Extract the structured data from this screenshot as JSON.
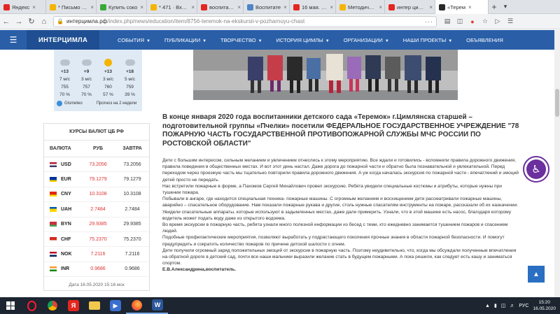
{
  "browser": {
    "tabs": [
      {
        "label": "Яндекс",
        "icon_color": "#e52620",
        "active": false
      },
      {
        "label": "* Письмо «Го",
        "icon_color": "#f5b400",
        "active": false
      },
      {
        "label": "Купить соко",
        "icon_color": "#3aa93a",
        "active": false
      },
      {
        "label": "* 471 · Входящ",
        "icon_color": "#f5b400",
        "active": false
      },
      {
        "label": "воспитател",
        "icon_color": "#e52620",
        "active": false
      },
      {
        "label": "Воспитате",
        "icon_color": "#4f86c6",
        "active": false
      },
      {
        "label": "16 мая. РФ",
        "icon_color": "#e52620",
        "active": false
      },
      {
        "label": "Методическ",
        "icon_color": "#f5b400",
        "active": false
      },
      {
        "label": "интер цимла",
        "icon_color": "#e52620",
        "active": false
      },
      {
        "label": "«Терем",
        "icon_color": "#2a2a2a",
        "active": true
      }
    ],
    "new_tab": "+",
    "url_host": "интерцимла.рф",
    "url_path": "/index.php/news/education/item/8756-teremok-na-ekskursii-v-pozharnuyu-chast",
    "url_menu": "···"
  },
  "site": {
    "brand": "ИНТЕРЦИМЛА",
    "menu": [
      "СОБЫТИЯ",
      "ПУБЛИКАЦИИ",
      "ТВОРЧЕСТВО",
      "ИСТОРИЯ ЦИМЛЫ",
      "ОРГАНИЗАЦИИ",
      "НАШИ ПРОЕКТЫ",
      "ОБЪЯВЛЕНИЯ"
    ],
    "menu_has_dropdown": [
      true,
      true,
      true,
      true,
      true,
      true,
      false
    ]
  },
  "weather": {
    "days": [
      "",
      "",
      "",
      ""
    ],
    "icons": [
      "cloud",
      "cloud",
      "sun",
      "cloud"
    ],
    "temps": [
      "+13",
      "+9",
      "+13",
      "+18"
    ],
    "winds": [
      "7 м/с",
      "3 м/с",
      "3 м/с",
      "5 м/с"
    ],
    "pressure": [
      "755",
      "757",
      "760",
      "759"
    ],
    "humidity": [
      "70 %",
      "70 %",
      "57 %",
      "39 %"
    ],
    "provider": "Gismeteo",
    "forecast_link": "Прогноз на 2 недели"
  },
  "currency": {
    "title": "КУРСЫ ВАЛЮТ ЦБ РФ",
    "headers": [
      "ВАЛЮТА",
      "РУБ",
      "ЗАВТРА"
    ],
    "rows": [
      {
        "code": "USD",
        "rub": "73.2056",
        "tomorrow": "73.2056",
        "flag": [
          "#b22234",
          "#ffffff",
          "#3c3b6e"
        ]
      },
      {
        "code": "EUR",
        "rub": "79.1279",
        "tomorrow": "79.1279",
        "flag": [
          "#003399",
          "#003399",
          "#ffcc00"
        ]
      },
      {
        "code": "CNY",
        "rub": "10.3108",
        "tomorrow": "10.3108",
        "flag": [
          "#de2910",
          "#de2910",
          "#ffde00"
        ]
      },
      {
        "code": "UAH",
        "rub": "2.7484",
        "tomorrow": "2.7484",
        "flag": [
          "#0057b7",
          "#ffd700",
          "#ffd700"
        ]
      },
      {
        "code": "BYN",
        "rub": "29.9385",
        "tomorrow": "29.9385",
        "flag": [
          "#c8313e",
          "#c8313e",
          "#4aa657"
        ]
      },
      {
        "code": "CHF",
        "rub": "75.2370",
        "tomorrow": "75.2370",
        "flag": [
          "#d52b1e",
          "#d52b1e",
          "#ffffff"
        ]
      },
      {
        "code": "NOK",
        "rub": "7.2116",
        "tomorrow": "7.2116",
        "flag": [
          "#ba0c2f",
          "#ffffff",
          "#00205b"
        ]
      },
      {
        "code": "INR",
        "rub": "0.9686",
        "tomorrow": "0.9686",
        "flag": [
          "#ff9933",
          "#ffffff",
          "#138808"
        ]
      }
    ],
    "date": "Дата 16.05.2020 15:16 мск"
  },
  "article": {
    "title": "В конце января 2020 года воспитанники детского сада «Теремок» г.Цимлянска старшей – подготовительной группы «Пчелки» посетили ФЕДЕРАЛЬНОЕ ГОСУДАРСТВЕННОЕ УЧРЕЖДЕНИЕ \"78 ПОЖАРНУЮ ЧАСТЬ ГОСУДАРСТВЕННОЙ ПРОТИВОПОЖАРНОЙ СЛУЖБЫ МЧС РОССИИ ПО РОСТОВСКОЙ ОБЛАСТИ\"",
    "paragraphs": [
      "Дети с большим интересом, сильным желанием и увлечением отнеслись к этому мероприятию. Все ждали и готовились - вспомнили правила дорожного движения, правила поведения в общественных местах. И вот этот день настал. Даже дорога до пожарной части и обратно была познавательной и увлекательной. Перед переходом через проезжую часть мы тщательно повторили правила дорожного движения. А уж когда началась экскурсия по пожарной части - впечатлений и эмоций детей просто не передать.",
      "Нас встретили пожарные в форме, а Пахомов Сергей Михайлович провел экскурсию. Ребята увидели специальные костюмы и атрибуты, которые нужны при тушении пожара.",
      "Побывали в ангаре, где находится специальная техника- пожарные машины. С огромным желанием и восхищением дети рассматривали пожарные машины, аварийно – спасательное оборудование. Нам показали пожарные рукава и другие, столь нужные спасателям инструменты на пожаре, рассказали об их назначении. Увидели спасательные аппараты, которые используют в задымленных местах, даже дали примерить. Узнали, что в этой машине есть насос, благодаря которому водитель может подать воду даже из открытого водоема.",
      "Во время экскурсии в пожарную часть, ребята узнали много полезной информации из бесед с теми, кто ежедневно занимается тушением пожаров и спасением людей.",
      "Подобные профилактические мероприятия, позволяют выработать у подрастающего поколения прочные знания в области пожарной безопасности. И помогут предупредить и сократить количество пожаров по причине детской шалости с огнем.",
      "Дети получили огромный заряд положительных эмоций от экскурсии в пожарную часть. Поэтому неудивительно, что, когда мы обсуждали полученные впечатления на обратной дороге в детский сад, почти все наши мальчики выразили желание стать в будущем пожарными. А пока решили, как следует есть кашу и заниматься спортом."
    ],
    "signature": "Е.В.Александрина,воспитатель."
  },
  "taskbar": {
    "tray_lang": "РУС",
    "time": "15:20",
    "date": "16.05.2020"
  }
}
